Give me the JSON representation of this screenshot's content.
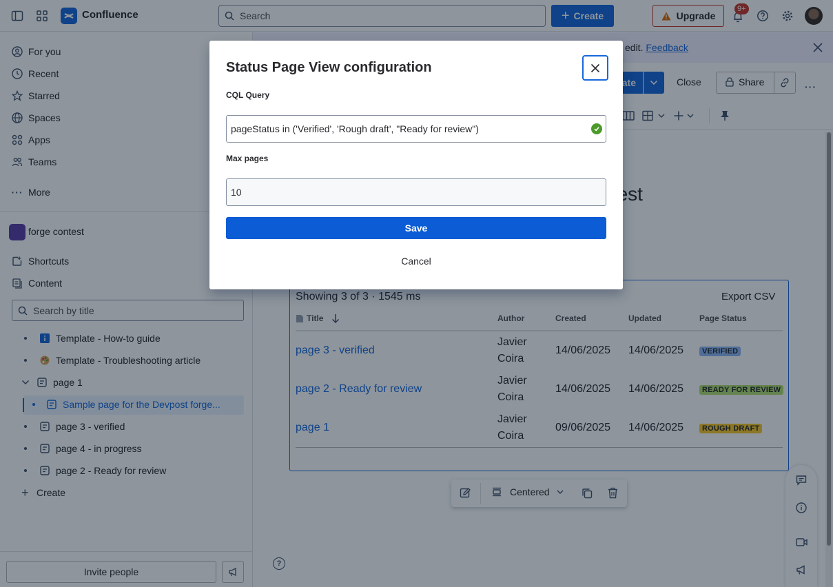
{
  "topbar": {
    "brand": "Confluence",
    "search_placeholder": "Search",
    "create_label": "Create",
    "upgrade_label": "Upgrade",
    "notifications_badge": "9+"
  },
  "sidebar": {
    "nav": [
      {
        "label": "For you",
        "icon": "person-circle-icon"
      },
      {
        "label": "Recent",
        "icon": "clock-icon"
      },
      {
        "label": "Starred",
        "icon": "star-icon"
      },
      {
        "label": "Spaces",
        "icon": "globe-icon"
      },
      {
        "label": "Apps",
        "icon": "apps-icon"
      },
      {
        "label": "Teams",
        "icon": "people-icon"
      }
    ],
    "more_label": "More",
    "space_name": "forge contest",
    "shortcuts_label": "Shortcuts",
    "content_label": "Content",
    "title_search_placeholder": "Search by title",
    "tree": [
      {
        "label": "Template - How-to guide",
        "icon": "info-emoji-icon"
      },
      {
        "label": "Template - Troubleshooting article",
        "icon": "palette-emoji-icon"
      },
      {
        "label": "page 1",
        "icon": "page-icon"
      },
      {
        "label": "Sample page for the Devpost forge...",
        "icon": "page-icon"
      },
      {
        "label": "page 3 - verified",
        "icon": "page-icon"
      },
      {
        "label": "page 4 - in progress",
        "icon": "page-icon"
      },
      {
        "label": "page 2 - Ready for review",
        "icon": "page-icon"
      }
    ],
    "tree_create_label": "Create",
    "invite_label": "Invite people"
  },
  "main": {
    "banner_text": "edit.",
    "banner_link": "Feedback",
    "update_label_fragment": "ate",
    "close_label": "Close",
    "share_label": "Share",
    "page_title_fragment": "uest",
    "macro": {
      "summary": "Showing 3 of 3 · 1545 ms",
      "export_label": "Export CSV",
      "columns": [
        "Title",
        "Author",
        "Created",
        "Updated",
        "Page Status"
      ],
      "rows": [
        {
          "title": "page 3 - verified",
          "author_first": "Javier",
          "author_last": "Coira",
          "created": "14/06/2025",
          "updated": "14/06/2025",
          "status": "VERIFIED",
          "status_color": "#8fb8f6"
        },
        {
          "title": "page 2 - Ready for review",
          "author_first": "Javier",
          "author_last": "Coira",
          "created": "14/06/2025",
          "updated": "14/06/2025",
          "status": "READY FOR REVIEW",
          "status_color": "#b3df72"
        },
        {
          "title": "page 1",
          "author_first": "Javier",
          "author_last": "Coira",
          "created": "09/06/2025",
          "updated": "14/06/2025",
          "status": "ROUGH DRAFT",
          "status_color": "#fbc828"
        }
      ]
    },
    "floatbar_width_label": "Centered"
  },
  "modal": {
    "title": "Status Page View configuration",
    "cql_label": "CQL Query",
    "cql_value": "pageStatus in ('Verified', 'Rough draft', \"Ready for review\")",
    "max_label": "Max pages",
    "max_value": "10",
    "save_label": "Save",
    "cancel_label": "Cancel"
  },
  "colors": {
    "primary": "#1868db",
    "upgrade_border": "#c9372c",
    "valid": "#4c9a2a"
  }
}
